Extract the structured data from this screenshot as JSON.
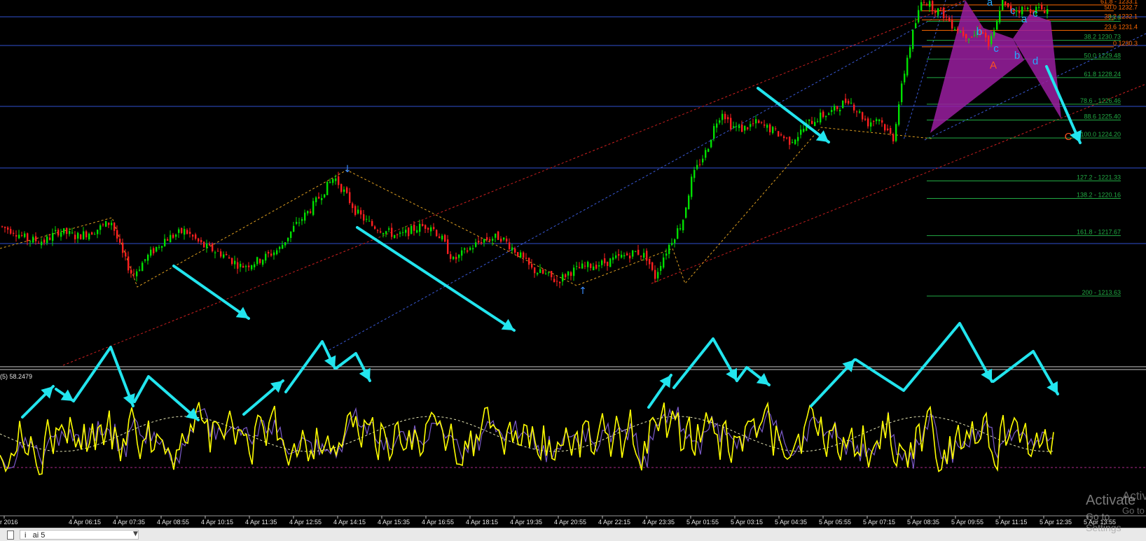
{
  "chart_data": [
    {
      "type": "candlestick",
      "panel": "price",
      "ohlc_source": "price.path",
      "fibonacci_levels": [
        {
          "label": "61.8 - 1233.1",
          "value": 1233.1,
          "color": "#ff6a00"
        },
        {
          "label": "50.0 1232.7",
          "value": 1232.7,
          "color": "#ff6a00"
        },
        {
          "label": "38.2 1232.1",
          "value": 1232.1,
          "color": "#ff6a00"
        },
        {
          "label": "23.6",
          "value": 1232.0,
          "color": "#22aa44"
        },
        {
          "label": "23.6 1231.4",
          "value": 1231.4,
          "color": "#ff6a00"
        },
        {
          "label": "38.2 1230.73",
          "value": 1230.73,
          "color": "#22aa44"
        },
        {
          "label": "0 1230.3",
          "value": 1230.3,
          "color": "#ff6a00"
        },
        {
          "label": "50.0 1229.48",
          "value": 1229.48,
          "color": "#22aa44"
        },
        {
          "label": "61.8 1228.24",
          "value": 1228.24,
          "color": "#22aa44"
        },
        {
          "label": "78.6 - 1226.46",
          "value": 1226.46,
          "color": "#22aa44"
        },
        {
          "label": "88.6 1225.40",
          "value": 1225.4,
          "color": "#22aa44"
        },
        {
          "label": "100.0 1224.20",
          "value": 1224.2,
          "color": "#22aa44"
        },
        {
          "label": "127.2 - 1221.33",
          "value": 1221.33,
          "color": "#22aa44"
        },
        {
          "label": "138.2 - 1220.16",
          "value": 1220.16,
          "color": "#22aa44"
        },
        {
          "label": "161.8 - 1217.67",
          "value": 1217.67,
          "color": "#22aa44"
        },
        {
          "label": "200 - 1213.63",
          "value": 1213.63,
          "color": "#22aa44"
        }
      ],
      "pattern_labels": [
        "a",
        "b",
        "c",
        "a",
        "c",
        "b",
        "c",
        "d",
        "A",
        "C"
      ],
      "x_tick_labels": [
        "r 2016",
        "4 Apr 06:15",
        "4 Apr 07:35",
        "4 Apr 08:55",
        "4 Apr 10:15",
        "4 Apr 11:35",
        "4 Apr 12:55",
        "4 Apr 14:15",
        "4 Apr 15:35",
        "4 Apr 16:55",
        "4 Apr 18:15",
        "4 Apr 19:35",
        "4 Apr 20:55",
        "4 Apr 22:15",
        "4 Apr 23:35",
        "5 Apr 01:55",
        "5 Apr 03:15",
        "5 Apr 04:35",
        "5 Apr 05:55",
        "5 Apr 07:15",
        "5 Apr 08:35",
        "5 Apr 09:55",
        "5 Apr 11:15",
        "5 Apr 12:35",
        "5 Apr 13:55"
      ],
      "colors": {
        "up": "#00e000",
        "down": "#ff2020",
        "horizontal_lines": "#3050d0",
        "channel_red": "#cc2020",
        "channel_blue": "#3a5ad8",
        "zigzag": "#e0a020",
        "pattern_fill": "#9a1fa0",
        "arrows": "#22e5ee"
      }
    },
    {
      "type": "line",
      "panel": "oscillator",
      "label": "(5) 58.2479",
      "series": [
        {
          "name": "",
          "color": "#ffff00"
        },
        {
          "name": "",
          "color": "#7b5ac8"
        },
        {
          "name": "",
          "color": "#e6e6b4"
        }
      ],
      "reference_line_color": "#aa2a8a"
    }
  ],
  "price": {
    "path": [
      [
        0,
        1218.3
      ],
      [
        20,
        1218.0
      ],
      [
        40,
        1217.4
      ],
      [
        65,
        1217.3
      ],
      [
        85,
        1218.0
      ],
      [
        110,
        1217.6
      ],
      [
        135,
        1218.0
      ],
      [
        160,
        1218.6
      ],
      [
        175,
        1216.5
      ],
      [
        190,
        1215.0
      ],
      [
        210,
        1216.2
      ],
      [
        235,
        1217.4
      ],
      [
        265,
        1218.0
      ],
      [
        290,
        1217.0
      ],
      [
        320,
        1216.4
      ],
      [
        345,
        1215.6
      ],
      [
        370,
        1216.0
      ],
      [
        400,
        1216.8
      ],
      [
        420,
        1218.2
      ],
      [
        445,
        1219.5
      ],
      [
        465,
        1220.8
      ],
      [
        478,
        1221.6
      ],
      [
        492,
        1220.6
      ],
      [
        510,
        1219.2
      ],
      [
        530,
        1218.4
      ],
      [
        550,
        1218.0
      ],
      [
        570,
        1217.6
      ],
      [
        595,
        1218.2
      ],
      [
        615,
        1218.4
      ],
      [
        632,
        1217.4
      ],
      [
        648,
        1216.0
      ],
      [
        665,
        1216.6
      ],
      [
        690,
        1217.4
      ],
      [
        715,
        1217.6
      ],
      [
        738,
        1216.6
      ],
      [
        760,
        1215.4
      ],
      [
        782,
        1215.0
      ],
      [
        796,
        1214.6
      ],
      [
        812,
        1215.2
      ],
      [
        835,
        1215.6
      ],
      [
        860,
        1215.8
      ],
      [
        885,
        1216.2
      ],
      [
        910,
        1216.6
      ],
      [
        925,
        1216.2
      ],
      [
        935,
        1214.8
      ],
      [
        945,
        1216.0
      ],
      [
        960,
        1217.4
      ],
      [
        975,
        1218.6
      ],
      [
        988,
        1221.4
      ],
      [
        1000,
        1222.6
      ],
      [
        1010,
        1223.4
      ],
      [
        1022,
        1225.2
      ],
      [
        1032,
        1226.0
      ],
      [
        1045,
        1225.0
      ],
      [
        1060,
        1224.8
      ],
      [
        1080,
        1225.2
      ],
      [
        1100,
        1224.8
      ],
      [
        1115,
        1224.4
      ],
      [
        1128,
        1224.0
      ],
      [
        1140,
        1224.4
      ],
      [
        1155,
        1225.2
      ],
      [
        1170,
        1225.6
      ],
      [
        1190,
        1226.0
      ],
      [
        1212,
        1226.8
      ],
      [
        1225,
        1226.0
      ],
      [
        1240,
        1225.2
      ],
      [
        1255,
        1225.6
      ],
      [
        1268,
        1224.6
      ],
      [
        1276,
        1224.2
      ],
      [
        1285,
        1226.8
      ],
      [
        1295,
        1229.4
      ],
      [
        1305,
        1231.4
      ],
      [
        1318,
        1233.6
      ],
      [
        1330,
        1233.0
      ],
      [
        1345,
        1232.6
      ],
      [
        1360,
        1231.8
      ],
      [
        1375,
        1231.2
      ],
      [
        1390,
        1231.0
      ],
      [
        1402,
        1231.6
      ],
      [
        1412,
        1230.4
      ],
      [
        1422,
        1231.4
      ],
      [
        1430,
        1233.4
      ],
      [
        1438,
        1232.8
      ]
    ]
  },
  "oscillator": {
    "label": "(5) 58.2479"
  },
  "bottom_bar": {
    "selector_text": "i        ai      5"
  },
  "watermark": {
    "line1": "Activate",
    "line2": "Go to Settings",
    "ghost1": "Activ",
    "ghost2": "Go to"
  }
}
